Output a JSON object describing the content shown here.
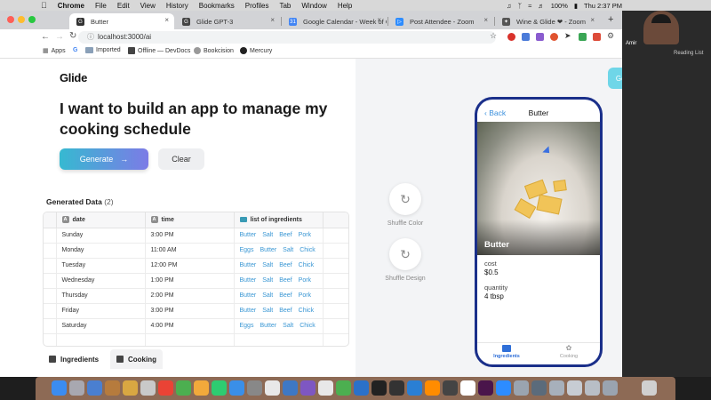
{
  "os_menu": {
    "apple": "",
    "items": [
      "Chrome",
      "File",
      "Edit",
      "View",
      "History",
      "Bookmarks",
      "Profiles",
      "Tab",
      "Window",
      "Help"
    ],
    "battery": "100%",
    "clock": "Thu 2:37 PM"
  },
  "browser": {
    "tabs": [
      {
        "title": "Butter",
        "active": true
      },
      {
        "title": "Glide GPT-3",
        "active": false
      },
      {
        "title": "Google Calendar - Week of Oc",
        "active": false
      },
      {
        "title": "Post Attendee - Zoom",
        "active": false
      },
      {
        "title": "Wine & Glide ❤ - Zoom",
        "active": false
      }
    ],
    "url": "localhost:3000/ai",
    "bookmarks": [
      "Apps",
      "Imported",
      "Offline — DevDocs",
      "Bookcision",
      "Mercury"
    ],
    "reading_list": "Reading List"
  },
  "app": {
    "logo": "Glide",
    "headline": "I want to build an app to manage my cooking schedule",
    "generate_label": "Generate",
    "clear_label": "Clear",
    "generated_title": "Generated Data",
    "generated_count": "(2)",
    "columns": [
      "date",
      "time",
      "list of ingredients"
    ],
    "rows": [
      {
        "date": "Sunday",
        "time": "3:00 PM",
        "ingredients": [
          "Butter",
          "Salt",
          "Beef",
          "Pork"
        ]
      },
      {
        "date": "Monday",
        "time": "11:00 AM",
        "ingredients": [
          "Eggs",
          "Butter",
          "Salt",
          "Chick"
        ]
      },
      {
        "date": "Tuesday",
        "time": "12:00 PM",
        "ingredients": [
          "Butter",
          "Salt",
          "Beef",
          "Chick"
        ]
      },
      {
        "date": "Wednesday",
        "time": "1:00 PM",
        "ingredients": [
          "Butter",
          "Salt",
          "Beef",
          "Pork"
        ]
      },
      {
        "date": "Thursday",
        "time": "2:00 PM",
        "ingredients": [
          "Butter",
          "Salt",
          "Beef",
          "Pork"
        ]
      },
      {
        "date": "Friday",
        "time": "3:00 PM",
        "ingredients": [
          "Butter",
          "Salt",
          "Beef",
          "Chick"
        ]
      },
      {
        "date": "Saturday",
        "time": "4:00 PM",
        "ingredients": [
          "Eggs",
          "Butter",
          "Salt",
          "Chick"
        ]
      }
    ],
    "table_tabs": [
      "Ingredients",
      "Cooking"
    ],
    "shuffle_color": "Shuffle Color",
    "shuffle_design": "Shuffle Design",
    "get_app": "Get this app"
  },
  "phone": {
    "back": "Back",
    "title": "Butter",
    "item_name": "Butter",
    "fields": [
      {
        "label": "cost",
        "value": "$0.5"
      },
      {
        "label": "quantity",
        "value": "4 tbsp"
      }
    ],
    "nav": [
      "Ingredients",
      "Cooking"
    ]
  },
  "participant": {
    "name": "Amir"
  },
  "colors": {
    "accent_blue": "#3a97d4",
    "generate_gradient_start": "#36b9d1",
    "generate_gradient_end": "#7c7be6",
    "get_app_button": "#6fd6e8",
    "phone_frame": "#1a2f8a"
  }
}
